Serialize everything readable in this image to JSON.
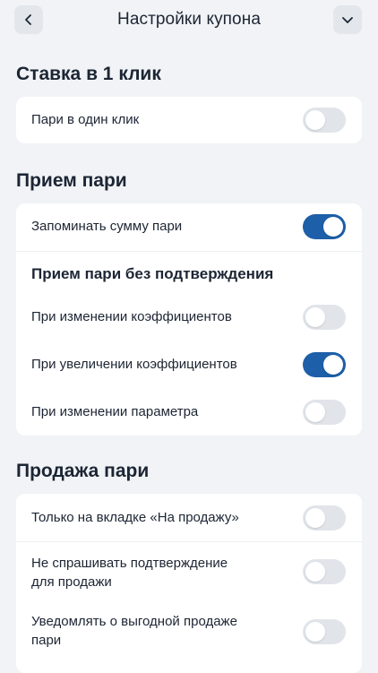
{
  "header": {
    "title": "Настройки купона",
    "back_icon": "chevron-left-icon",
    "collapse_icon": "chevron-down-icon"
  },
  "colors": {
    "toggle_on": "#1d5fa8",
    "toggle_off": "#e1e5ea",
    "background": "#f1f3f6"
  },
  "sections": {
    "one_click": {
      "title": "Ставка в 1 клик",
      "rows": [
        {
          "label": "Пари в один клик",
          "enabled": false
        }
      ]
    },
    "accept": {
      "title": "Прием пари",
      "remember_sum": {
        "label": "Запоминать сумму пари",
        "enabled": true
      },
      "no_confirm_heading": "Прием пари без подтверждения",
      "rows": [
        {
          "label": "При изменении коэффициентов",
          "enabled": false
        },
        {
          "label": "При увеличении коэффициентов",
          "enabled": true
        },
        {
          "label": "При изменении параметра",
          "enabled": false
        }
      ]
    },
    "sale": {
      "title": "Продажа пари",
      "rows": [
        {
          "label": "Только на вкладке «На продажу»",
          "enabled": false
        },
        {
          "label_line1": "Не спрашивать подтверждение",
          "label_line2": "для продажи",
          "enabled": false
        },
        {
          "label_line1": "Уведомлять о выгодной продаже",
          "label_line2": "пари",
          "enabled": false
        }
      ]
    }
  }
}
